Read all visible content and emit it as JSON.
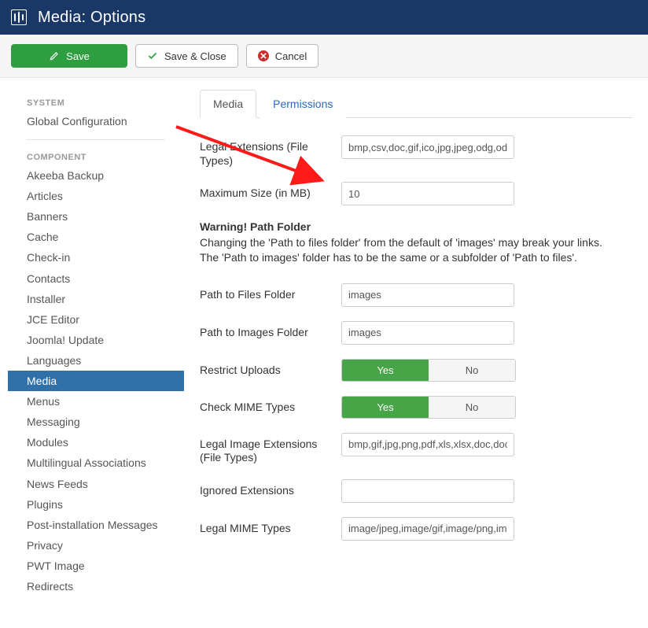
{
  "header": {
    "title": "Media: Options"
  },
  "toolbar": {
    "save": "Save",
    "save_close": "Save & Close",
    "cancel": "Cancel"
  },
  "sidebar": {
    "heading_system": "SYSTEM",
    "global_config": "Global Configuration",
    "heading_component": "COMPONENT",
    "items": [
      "Akeeba Backup",
      "Articles",
      "Banners",
      "Cache",
      "Check-in",
      "Contacts",
      "Installer",
      "JCE Editor",
      "Joomla! Update",
      "Languages",
      "Media",
      "Menus",
      "Messaging",
      "Modules",
      "Multilingual Associations",
      "News Feeds",
      "Plugins",
      "Post-installation Messages",
      "Privacy",
      "PWT Image",
      "Redirects"
    ],
    "active_index": 10
  },
  "tabs": {
    "media": "Media",
    "permissions": "Permissions"
  },
  "form": {
    "legal_ext_label": "Legal Extensions (File Types)",
    "legal_ext_value": "bmp,csv,doc,gif,ico,jpg,jpeg,odg,odp,ods,odt,pdf,png,ppt,swf,txt,xcf,xls,BMP,CSV,DOC,GIF,ICO,JPG,JPEG,ODG,ODP,ODS,ODT,PDF,PNG,PPT,SWF,TXT,XCF,XLS",
    "max_size_label": "Maximum Size (in MB)",
    "max_size_value": "10",
    "warn_title": "Warning! Path Folder",
    "warn_text": "Changing the 'Path to files folder' from the default of 'images' may break your links. The 'Path to images' folder has to be the same or a subfolder of 'Path to files'.",
    "path_files_label": "Path to Files Folder",
    "path_files_value": "images",
    "path_images_label": "Path to Images Folder",
    "path_images_value": "images",
    "restrict_label": "Restrict Uploads",
    "mime_check_label": "Check MIME Types",
    "legal_img_label": "Legal Image Extensions (File Types)",
    "legal_img_value": "bmp,gif,jpg,png,pdf,xls,xlsx,doc,docx",
    "ignored_ext_label": "Ignored Extensions",
    "ignored_ext_value": "",
    "legal_mime_label": "Legal MIME Types",
    "legal_mime_value": "image/jpeg,image/gif,image/png,image/bmp,application/x-shockwave-flash,application/msword,application/excel,application/pdf,application/powerpoint,text/plain,application/x-zip",
    "yes": "Yes",
    "no": "No"
  }
}
